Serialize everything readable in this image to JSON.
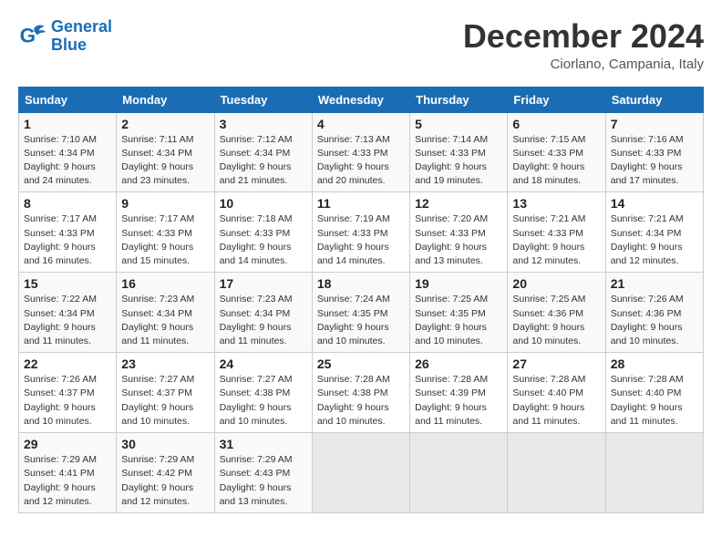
{
  "logo": {
    "line1": "General",
    "line2": "Blue"
  },
  "title": "December 2024",
  "location": "Ciorlano, Campania, Italy",
  "days_of_week": [
    "Sunday",
    "Monday",
    "Tuesday",
    "Wednesday",
    "Thursday",
    "Friday",
    "Saturday"
  ],
  "weeks": [
    [
      {
        "day": 1,
        "info": "Sunrise: 7:10 AM\nSunset: 4:34 PM\nDaylight: 9 hours\nand 24 minutes."
      },
      {
        "day": 2,
        "info": "Sunrise: 7:11 AM\nSunset: 4:34 PM\nDaylight: 9 hours\nand 23 minutes."
      },
      {
        "day": 3,
        "info": "Sunrise: 7:12 AM\nSunset: 4:34 PM\nDaylight: 9 hours\nand 21 minutes."
      },
      {
        "day": 4,
        "info": "Sunrise: 7:13 AM\nSunset: 4:33 PM\nDaylight: 9 hours\nand 20 minutes."
      },
      {
        "day": 5,
        "info": "Sunrise: 7:14 AM\nSunset: 4:33 PM\nDaylight: 9 hours\nand 19 minutes."
      },
      {
        "day": 6,
        "info": "Sunrise: 7:15 AM\nSunset: 4:33 PM\nDaylight: 9 hours\nand 18 minutes."
      },
      {
        "day": 7,
        "info": "Sunrise: 7:16 AM\nSunset: 4:33 PM\nDaylight: 9 hours\nand 17 minutes."
      }
    ],
    [
      {
        "day": 8,
        "info": "Sunrise: 7:17 AM\nSunset: 4:33 PM\nDaylight: 9 hours\nand 16 minutes."
      },
      {
        "day": 9,
        "info": "Sunrise: 7:17 AM\nSunset: 4:33 PM\nDaylight: 9 hours\nand 15 minutes."
      },
      {
        "day": 10,
        "info": "Sunrise: 7:18 AM\nSunset: 4:33 PM\nDaylight: 9 hours\nand 14 minutes."
      },
      {
        "day": 11,
        "info": "Sunrise: 7:19 AM\nSunset: 4:33 PM\nDaylight: 9 hours\nand 14 minutes."
      },
      {
        "day": 12,
        "info": "Sunrise: 7:20 AM\nSunset: 4:33 PM\nDaylight: 9 hours\nand 13 minutes."
      },
      {
        "day": 13,
        "info": "Sunrise: 7:21 AM\nSunset: 4:33 PM\nDaylight: 9 hours\nand 12 minutes."
      },
      {
        "day": 14,
        "info": "Sunrise: 7:21 AM\nSunset: 4:34 PM\nDaylight: 9 hours\nand 12 minutes."
      }
    ],
    [
      {
        "day": 15,
        "info": "Sunrise: 7:22 AM\nSunset: 4:34 PM\nDaylight: 9 hours\nand 11 minutes."
      },
      {
        "day": 16,
        "info": "Sunrise: 7:23 AM\nSunset: 4:34 PM\nDaylight: 9 hours\nand 11 minutes."
      },
      {
        "day": 17,
        "info": "Sunrise: 7:23 AM\nSunset: 4:34 PM\nDaylight: 9 hours\nand 11 minutes."
      },
      {
        "day": 18,
        "info": "Sunrise: 7:24 AM\nSunset: 4:35 PM\nDaylight: 9 hours\nand 10 minutes."
      },
      {
        "day": 19,
        "info": "Sunrise: 7:25 AM\nSunset: 4:35 PM\nDaylight: 9 hours\nand 10 minutes."
      },
      {
        "day": 20,
        "info": "Sunrise: 7:25 AM\nSunset: 4:36 PM\nDaylight: 9 hours\nand 10 minutes."
      },
      {
        "day": 21,
        "info": "Sunrise: 7:26 AM\nSunset: 4:36 PM\nDaylight: 9 hours\nand 10 minutes."
      }
    ],
    [
      {
        "day": 22,
        "info": "Sunrise: 7:26 AM\nSunset: 4:37 PM\nDaylight: 9 hours\nand 10 minutes."
      },
      {
        "day": 23,
        "info": "Sunrise: 7:27 AM\nSunset: 4:37 PM\nDaylight: 9 hours\nand 10 minutes."
      },
      {
        "day": 24,
        "info": "Sunrise: 7:27 AM\nSunset: 4:38 PM\nDaylight: 9 hours\nand 10 minutes."
      },
      {
        "day": 25,
        "info": "Sunrise: 7:28 AM\nSunset: 4:38 PM\nDaylight: 9 hours\nand 10 minutes."
      },
      {
        "day": 26,
        "info": "Sunrise: 7:28 AM\nSunset: 4:39 PM\nDaylight: 9 hours\nand 11 minutes."
      },
      {
        "day": 27,
        "info": "Sunrise: 7:28 AM\nSunset: 4:40 PM\nDaylight: 9 hours\nand 11 minutes."
      },
      {
        "day": 28,
        "info": "Sunrise: 7:28 AM\nSunset: 4:40 PM\nDaylight: 9 hours\nand 11 minutes."
      }
    ],
    [
      {
        "day": 29,
        "info": "Sunrise: 7:29 AM\nSunset: 4:41 PM\nDaylight: 9 hours\nand 12 minutes."
      },
      {
        "day": 30,
        "info": "Sunrise: 7:29 AM\nSunset: 4:42 PM\nDaylight: 9 hours\nand 12 minutes."
      },
      {
        "day": 31,
        "info": "Sunrise: 7:29 AM\nSunset: 4:43 PM\nDaylight: 9 hours\nand 13 minutes."
      },
      null,
      null,
      null,
      null
    ]
  ]
}
